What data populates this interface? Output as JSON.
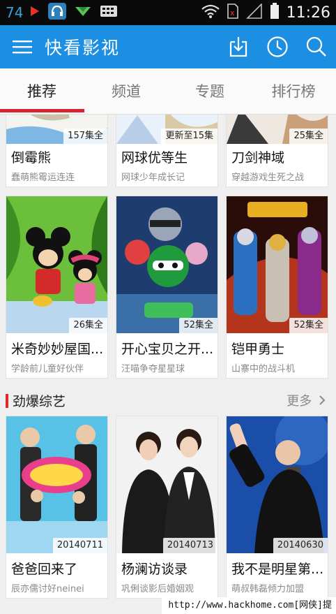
{
  "status_bar": {
    "left_number": "74",
    "time": "11:26",
    "icons": [
      "play-icon",
      "headset-icon",
      "download-arrow-icon",
      "keyboard-icon",
      "wifi-icon",
      "sim-icon",
      "signal-icon",
      "battery-icon"
    ]
  },
  "app_bar": {
    "title": "快看影视",
    "icons": [
      "menu-icon",
      "download-icon",
      "history-icon",
      "search-icon"
    ],
    "color": "#1d8fe3"
  },
  "tabs": [
    {
      "label": "推荐",
      "active": true
    },
    {
      "label": "频道",
      "active": false
    },
    {
      "label": "专题",
      "active": false
    },
    {
      "label": "排行榜",
      "active": false
    }
  ],
  "accent_color": "#d9232d",
  "row1": [
    {
      "badge": "157集全",
      "title": "倒霉熊",
      "subtitle": "蠢萌熊霉运连连"
    },
    {
      "badge": "更新至15集",
      "title": "网球优等生",
      "subtitle": "网球少年成长记"
    },
    {
      "badge": "25集全",
      "title": "刀剑神域",
      "subtitle": "穿越游戏生死之战"
    }
  ],
  "row2": [
    {
      "badge": "26集全",
      "title": "米奇妙妙屋国...",
      "subtitle": "学龄前儿童好伙伴"
    },
    {
      "badge": "52集全",
      "title": "开心宝贝之开...",
      "subtitle": "汪喵争夺星星球"
    },
    {
      "badge": "52集全",
      "title": "铠甲勇士",
      "subtitle": "山寨中的战斗机"
    }
  ],
  "section_variety": {
    "title": "劲爆综艺",
    "more": "更多"
  },
  "row3": [
    {
      "badge": "20140711",
      "title": "爸爸回来了",
      "subtitle": "辰亦儒讨好neinei"
    },
    {
      "badge": "20140713",
      "title": "杨澜访谈录",
      "subtitle": "巩俐谈影后婚姻观"
    },
    {
      "badge": "20140630",
      "title": "我不是明星第...",
      "subtitle": "萌叔韩磊倾力加盟"
    }
  ],
  "watermark": "http://www.hackhome.com[网侠]提供"
}
